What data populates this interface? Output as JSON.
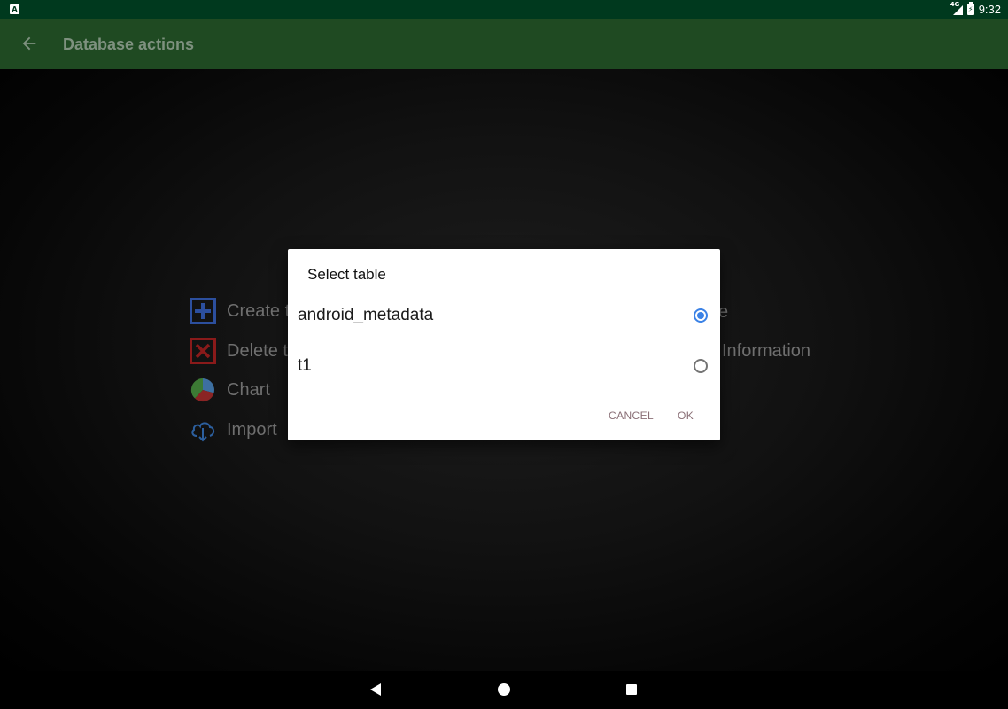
{
  "status_bar": {
    "left_icon": "A",
    "network_label": "4G",
    "time": "9:32"
  },
  "app_bar": {
    "title": "Database actions",
    "back_icon": "arrow-back-icon"
  },
  "background_actions": [
    {
      "label": "Create t",
      "icon": "plus-box-icon"
    },
    {
      "label": "Delete t",
      "icon": "x-box-icon"
    },
    {
      "label": "Chart",
      "icon": "pie-chart-icon"
    },
    {
      "label": "Import",
      "icon": "cloud-download-icon"
    },
    {
      "label": "e",
      "icon": ""
    },
    {
      "label": "Information",
      "icon": ""
    }
  ],
  "dialog": {
    "title": "Select table",
    "options": [
      {
        "label": "android_metadata",
        "selected": true
      },
      {
        "label": "t1",
        "selected": false
      }
    ],
    "cancel_label": "CANCEL",
    "ok_label": "OK"
  },
  "colors": {
    "status_bar": "#00391e",
    "app_bar_dimmed": "#1f4a22",
    "radio_accent": "#3b82e6",
    "dialog_button_text": "#8a6f76"
  }
}
